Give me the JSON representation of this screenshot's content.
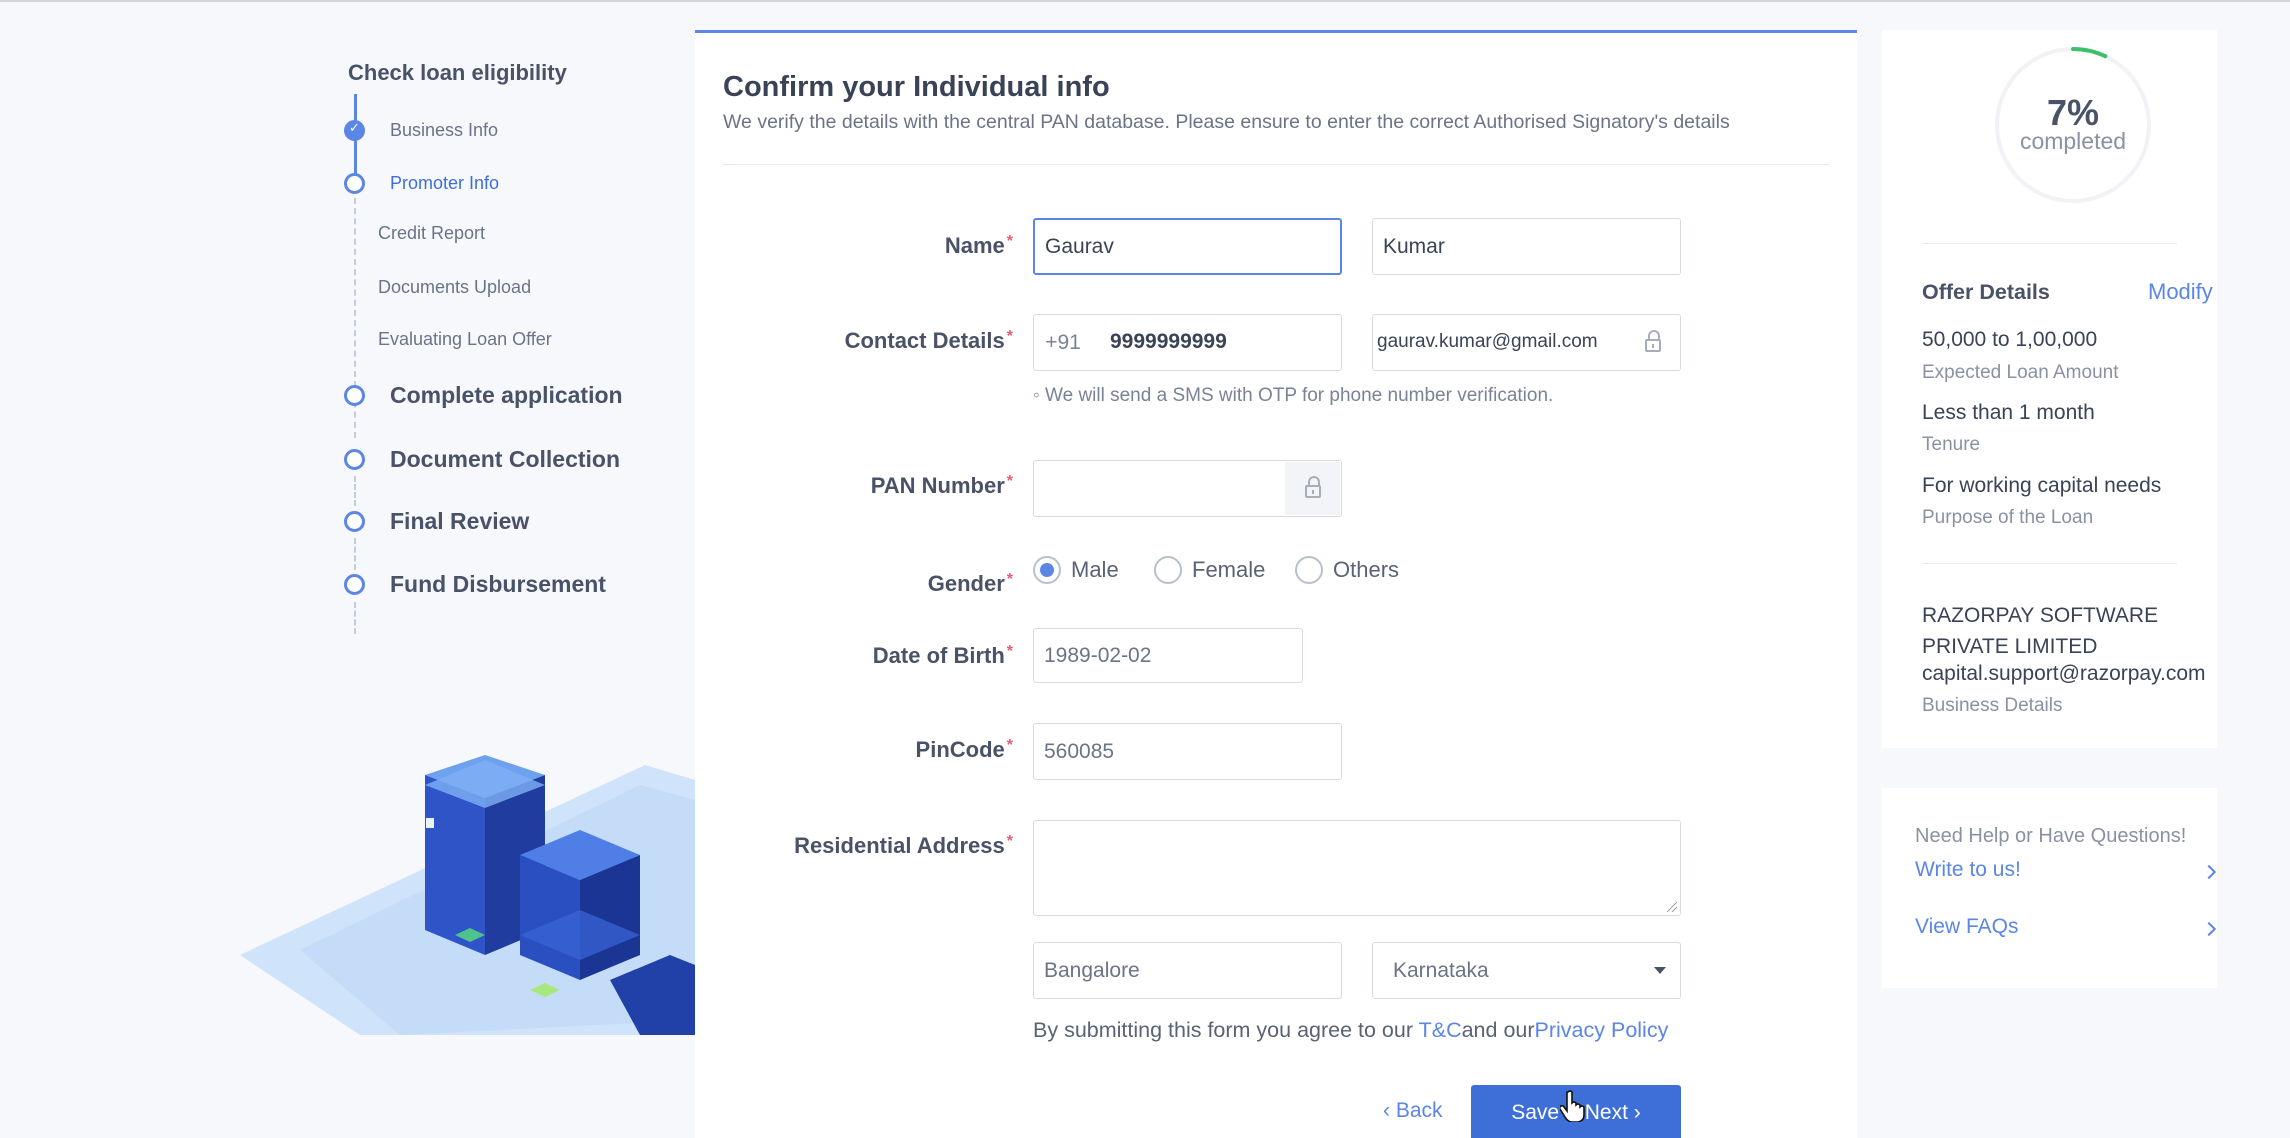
{
  "stepper": {
    "title": "Check loan eligibility",
    "substeps": [
      {
        "label": "Business Info",
        "state": "done"
      },
      {
        "label": "Promoter Info",
        "state": "active"
      },
      {
        "label": "Credit Report",
        "state": "pending"
      },
      {
        "label": "Documents Upload",
        "state": "pending"
      },
      {
        "label": "Evaluating Loan Offer",
        "state": "pending"
      }
    ],
    "steps": [
      {
        "label": "Complete application"
      },
      {
        "label": "Document Collection"
      },
      {
        "label": "Final Review"
      },
      {
        "label": "Fund Disbursement"
      }
    ]
  },
  "form": {
    "title": "Confirm your Individual info",
    "subtitle": "We verify the details with the central PAN database. Please ensure to enter the correct Authorised Signatory's details",
    "required_mark": "*",
    "name": {
      "label": "Name",
      "first": "Gaurav",
      "last": "Kumar"
    },
    "contact": {
      "label": "Contact Details",
      "country_code": "+91",
      "phone": "9999999999",
      "email": "gaurav.kumar@gmail.com",
      "hint": "◦ We will send a SMS with OTP for phone number verification."
    },
    "pan": {
      "label": "PAN Number",
      "value": ""
    },
    "gender": {
      "label": "Gender",
      "options": [
        "Male",
        "Female",
        "Others"
      ],
      "selected": "Male"
    },
    "dob": {
      "label": "Date of Birth",
      "value": "1989-02-02"
    },
    "pincode": {
      "label": "PinCode",
      "value": "560085"
    },
    "address": {
      "label": "Residential Address",
      "value": "",
      "city": "Bangalore",
      "state": "Karnataka"
    },
    "terms": {
      "prefix": "By submitting this form you agree to our ",
      "tc": "T&C",
      "mid": "and our",
      "privacy": "Privacy Policy"
    },
    "back_label": "‹ Back",
    "save_label": "Save & Next ›"
  },
  "progress": {
    "percent_text": "7%",
    "label": "completed",
    "fraction": 0.07
  },
  "offer": {
    "title": "Offer Details",
    "modify": "Modify",
    "amount": "50,000 to 1,00,000",
    "amount_caption": "Expected Loan Amount",
    "tenure": "Less than 1 month",
    "tenure_caption": "Tenure",
    "purpose": "For working capital needs",
    "purpose_caption": "Purpose of the Loan",
    "business_name": "RAZORPAY SOFTWARE PRIVATE LIMITED",
    "business_email": "capital.support@razorpay.com",
    "business_caption": "Business Details"
  },
  "help": {
    "question": "Need Help or Have Questions!",
    "write": "Write to us!",
    "faqs": "View FAQs"
  },
  "colors": {
    "accent": "#5b86e5",
    "primary_button": "#3e6fd8",
    "required": "#e25d6f",
    "background": "#f6f8fb"
  },
  "icons": [
    "check-icon",
    "lock-icon",
    "chevron-right-icon",
    "dropdown-caret-icon",
    "hand-cursor-icon"
  ]
}
